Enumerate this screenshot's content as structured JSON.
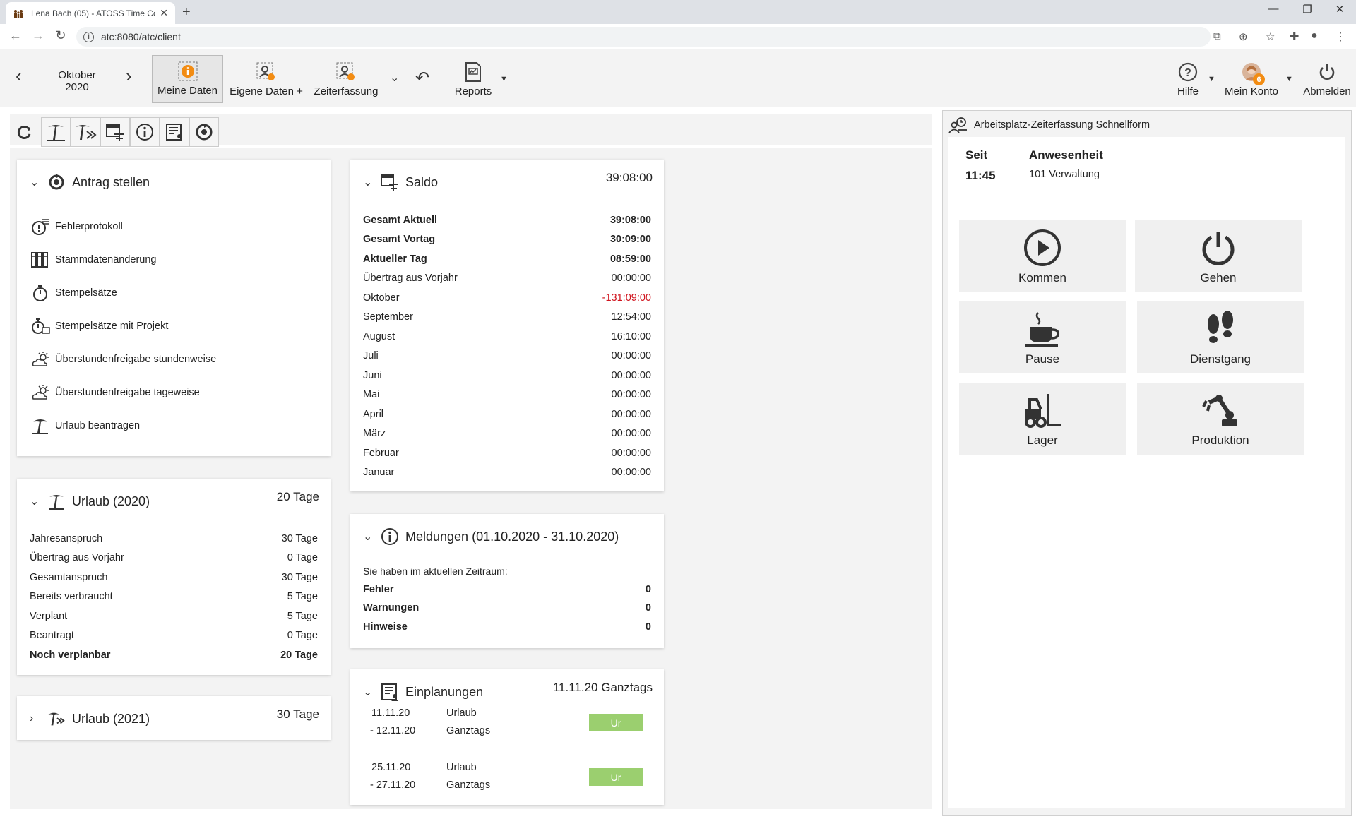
{
  "browser": {
    "tab_title": "Lena Bach (05) - ATOSS Time Co",
    "url": "atc:8080/atc/client"
  },
  "toolbar": {
    "month": "Oktober",
    "year": "2020",
    "buttons": [
      "Meine Daten",
      "Eigene Daten +",
      "Zeiterfassung",
      "Reports"
    ],
    "help": "Hilfe",
    "account": "Mein Konto",
    "account_badge": "6",
    "logout": "Abmelden"
  },
  "antrag": {
    "title": "Antrag stellen",
    "items": [
      "Fehlerprotokoll",
      "Stammdatenänderung",
      "Stempelsätze",
      "Stempelsätze mit Projekt",
      "Überstundenfreigabe stundenweise",
      "Überstundenfreigabe tageweise",
      "Urlaub beantragen"
    ]
  },
  "urlaub2020": {
    "title": "Urlaub (2020)",
    "value": "20 Tage",
    "rows": [
      {
        "label": "Jahresanspruch",
        "value": "30 Tage"
      },
      {
        "label": "Übertrag aus Vorjahr",
        "value": "0 Tage"
      },
      {
        "label": "Gesamtanspruch",
        "value": "30 Tage"
      },
      {
        "label": "Bereits verbraucht",
        "value": "5 Tage"
      },
      {
        "label": "Verplant",
        "value": "5 Tage"
      },
      {
        "label": "Beantragt",
        "value": "0 Tage"
      },
      {
        "label": "Noch verplanbar",
        "value": "20 Tage"
      }
    ]
  },
  "urlaub2021": {
    "title": "Urlaub (2021)",
    "value": "30 Tage"
  },
  "saldo": {
    "title": "Saldo",
    "value": "39:08:00",
    "rows": [
      {
        "label": "Gesamt Aktuell",
        "value": "39:08:00"
      },
      {
        "label": "Gesamt Vortag",
        "value": "30:09:00"
      },
      {
        "label": "Aktueller Tag",
        "value": "08:59:00"
      },
      {
        "label": "Übertrag aus Vorjahr",
        "value": "00:00:00"
      },
      {
        "label": "Oktober",
        "value": "-131:09:00"
      },
      {
        "label": "September",
        "value": "12:54:00"
      },
      {
        "label": "August",
        "value": "16:10:00"
      },
      {
        "label": "Juli",
        "value": "00:00:00"
      },
      {
        "label": "Juni",
        "value": "00:00:00"
      },
      {
        "label": "Mai",
        "value": "00:00:00"
      },
      {
        "label": "April",
        "value": "00:00:00"
      },
      {
        "label": "März",
        "value": "00:00:00"
      },
      {
        "label": "Februar",
        "value": "00:00:00"
      },
      {
        "label": "Januar",
        "value": "00:00:00"
      }
    ]
  },
  "meldungen": {
    "title": "Meldungen (01.10.2020 - 31.10.2020)",
    "intro": "Sie haben im aktuellen Zeitraum:",
    "rows": [
      {
        "label": "Fehler",
        "value": "0"
      },
      {
        "label": "Warnungen",
        "value": "0"
      },
      {
        "label": "Hinweise",
        "value": "0"
      }
    ]
  },
  "einplanungen": {
    "title": "Einplanungen",
    "value": "11.11.20 Ganztags",
    "entries": [
      {
        "from": "11.11.20",
        "to": "- 12.11.20",
        "type": "Urlaub",
        "duration": "Ganztags",
        "code": "Ur"
      },
      {
        "from": "25.11.20",
        "to": "- 27.11.20",
        "type": "Urlaub",
        "duration": "Ganztags",
        "code": "Ur"
      }
    ]
  },
  "zeiterfassung": {
    "tab": "Arbeitsplatz-Zeiterfassung Schnellform",
    "seit_label": "Seit",
    "seit_value": "11:45",
    "anw_label": "Anwesenheit",
    "anw_value": "101 Verwaltung",
    "tiles": [
      "Kommen",
      "Gehen",
      "Pause",
      "Dienstgang",
      "Lager",
      "Produktion"
    ]
  },
  "colors": {
    "negative": "#d0141e",
    "badge": "#f28c13",
    "ur_tag": "#9bcf6f",
    "info_orange": "#f28c13"
  }
}
